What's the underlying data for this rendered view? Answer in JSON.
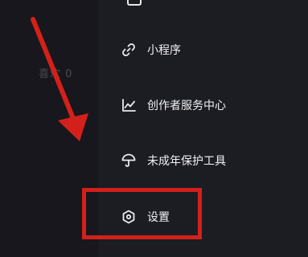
{
  "profile": {
    "likes_label": "喜欢 0"
  },
  "menu": {
    "items": [
      {
        "id": "mini-program",
        "label": "小程序",
        "icon": "link-icon"
      },
      {
        "id": "creator-center",
        "label": "创作者服务中心",
        "icon": "chart-icon"
      },
      {
        "id": "minor-protection",
        "label": "未成年保护工具",
        "icon": "umbrella-icon"
      },
      {
        "id": "settings",
        "label": "设置",
        "icon": "hexagon-gear-icon"
      }
    ]
  },
  "annotation": {
    "color": "#d4201a",
    "target": "settings"
  }
}
